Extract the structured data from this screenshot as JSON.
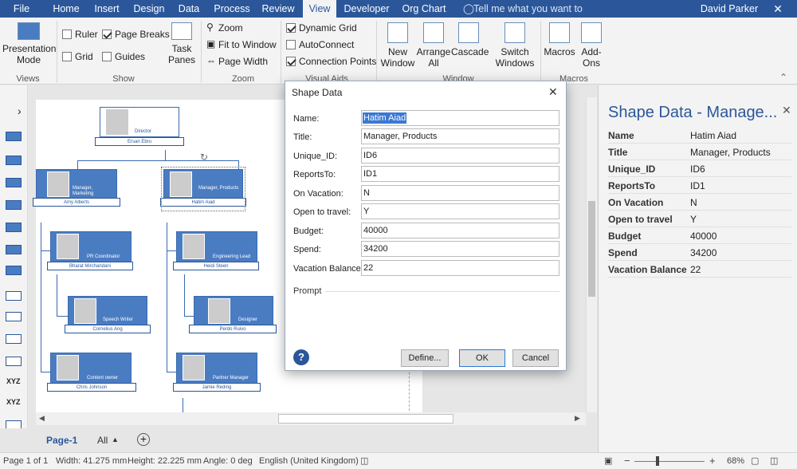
{
  "tabs": [
    "File",
    "Home",
    "Insert",
    "Design",
    "Data",
    "Process",
    "Review",
    "View",
    "Developer",
    "Org Chart"
  ],
  "tell_me": "Tell me what you want to do...",
  "user": "David Parker",
  "ribbon": {
    "views": {
      "presentation": "Presentation Mode",
      "label": "Views"
    },
    "show": {
      "ruler": "Ruler",
      "page_breaks": "Page Breaks",
      "grid": "Grid",
      "guides": "Guides",
      "task_panes": "Task Panes",
      "label": "Show"
    },
    "zoom": {
      "zoom": "Zoom",
      "fit": "Fit to Window",
      "page_width": "Page Width",
      "label": "Zoom"
    },
    "visual_aids": {
      "dynamic_grid": "Dynamic Grid",
      "autoconnect": "AutoConnect",
      "connection_points": "Connection Points",
      "label": "Visual Aids"
    },
    "window": {
      "new_window": "New Window",
      "arrange_all": "Arrange All",
      "cascade": "Cascade",
      "switch_windows": "Switch Windows",
      "label": "Window"
    },
    "macros": {
      "macros": "Macros",
      "addons": "Add-Ons",
      "label": "Macros"
    }
  },
  "orgchart": [
    {
      "name": "Ersan Ebru",
      "title": "Director"
    },
    {
      "name": "Amy Alberts",
      "title": "Manager, Marketing"
    },
    {
      "name": "Hatim Aiad",
      "title": "Manager, Products"
    },
    {
      "name": "Bharat Mirchandani",
      "title": "PR Coordinator"
    },
    {
      "name": "Heidi Steen",
      "title": "Engineering Lead"
    },
    {
      "name": "Cornelius Ang",
      "title": "Speech Writer"
    },
    {
      "name": "Perdo Ruivo",
      "title": "Designer"
    },
    {
      "name": "Chris Johnson",
      "title": "Content owner"
    },
    {
      "name": "Jamie Reding",
      "title": "Partner Manager"
    }
  ],
  "dialog": {
    "title": "Shape Data",
    "fields": [
      {
        "label": "Name:",
        "value": "Hatim Aiad"
      },
      {
        "label": "Title:",
        "value": "Manager, Products"
      },
      {
        "label": "Unique_ID:",
        "value": "ID6"
      },
      {
        "label": "ReportsTo:",
        "value": "ID1"
      },
      {
        "label": "On Vacation:",
        "value": "N"
      },
      {
        "label": "Open to travel:",
        "value": "Y"
      },
      {
        "label": "Budget:",
        "value": "40000"
      },
      {
        "label": "Spend:",
        "value": "34200"
      },
      {
        "label": "Vacation Balance:",
        "value": "22"
      }
    ],
    "prompt_label": "Prompt",
    "define_button": "Define...",
    "ok_button": "OK",
    "cancel_button": "Cancel"
  },
  "panel": {
    "title": "Shape Data - Manage...",
    "rows": [
      {
        "key": "Name",
        "value": "Hatim Aiad"
      },
      {
        "key": "Title",
        "value": "Manager, Products"
      },
      {
        "key": "Unique_ID",
        "value": "ID6"
      },
      {
        "key": "ReportsTo",
        "value": "ID1"
      },
      {
        "key": "On Vacation",
        "value": "N"
      },
      {
        "key": "Open to travel",
        "value": "Y"
      },
      {
        "key": "Budget",
        "value": "40000"
      },
      {
        "key": "Spend",
        "value": "34200"
      },
      {
        "key": "Vacation Balance",
        "value": "22"
      }
    ]
  },
  "pagebar": {
    "page": "Page-1",
    "all": "All"
  },
  "status": {
    "page": "Page 1 of 1",
    "width": "Width: 41.275 mm",
    "height": "Height: 22.225 mm",
    "angle": "Angle: 0 deg",
    "language": "English (United Kingdom)",
    "zoom": "68%"
  }
}
